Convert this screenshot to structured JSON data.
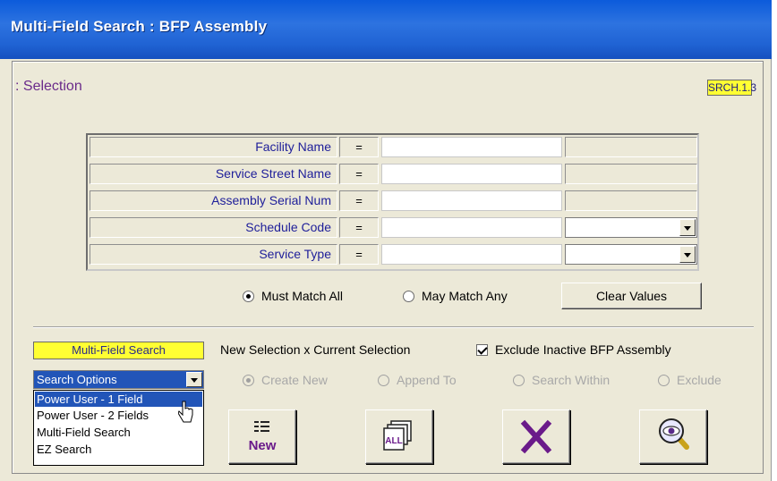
{
  "window": {
    "title": "Multi-Field Search :  BFP Assembly"
  },
  "section": {
    "title": ": Selection",
    "code": "SRCH.1.3"
  },
  "fields": [
    {
      "label": "Facility Name",
      "op": "=",
      "value": ""
    },
    {
      "label": "Service Street Name",
      "op": "=",
      "value": ""
    },
    {
      "label": "Assembly Serial Num",
      "op": "=",
      "value": ""
    },
    {
      "label": "Schedule Code",
      "op": "=",
      "value": "",
      "extra": ""
    },
    {
      "label": "Service Type",
      "op": "=",
      "value": "",
      "extra": ""
    }
  ],
  "match": {
    "all_label": "Must Match All",
    "any_label": "May Match Any",
    "selected": "all"
  },
  "clear_label": "Clear Values",
  "mode_label": "Multi-Field Search",
  "new_selection_label": "New Selection x Current Selection",
  "exclude_inactive": {
    "label": "Exclude Inactive BFP Assembly",
    "checked": true
  },
  "search_options": {
    "value": "Search Options",
    "options": [
      "Power User - 1 Field",
      "Power User - 2 Fields",
      "Multi-Field Search",
      "EZ Search"
    ],
    "highlighted": "Power User - 1 Field"
  },
  "selection_modes": [
    {
      "label": "Create New",
      "selected": true
    },
    {
      "label": "Append To",
      "selected": false
    },
    {
      "label": "Search Within",
      "selected": false
    },
    {
      "label": "Exclude",
      "selected": false
    }
  ],
  "buttons": {
    "new_label": "New",
    "all_label": "ALL"
  },
  "colors": {
    "accent_purple": "#6a1a8a",
    "highlight_yellow": "#ffff33",
    "label_blue": "#20209a",
    "selection_blue": "#2255b8"
  },
  "icons": [
    "new-list-icon",
    "all-records-icon",
    "close-x-icon",
    "magnify-eye-icon",
    "pointer-cursor-icon"
  ]
}
